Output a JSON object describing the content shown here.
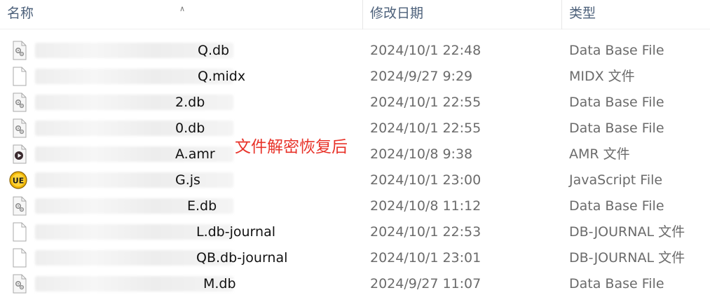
{
  "columns": {
    "name": "名称",
    "date": "修改日期",
    "type": "类型"
  },
  "overlay_text": "文件解密恢复后",
  "files": [
    {
      "name_suffix": "Q.db",
      "date": "2024/10/1 22:48",
      "type": "Data Base File",
      "icon": "database-file-icon"
    },
    {
      "name_suffix": "Q.midx",
      "date": "2024/9/27 9:29",
      "type": "MIDX 文件",
      "icon": "generic-file-icon"
    },
    {
      "name_suffix": "2.db",
      "date": "2024/10/1 22:55",
      "type": "Data Base File",
      "icon": "database-file-icon"
    },
    {
      "name_suffix": "0.db",
      "date": "2024/10/1 22:55",
      "type": "Data Base File",
      "icon": "database-file-icon"
    },
    {
      "name_suffix": "A.amr",
      "date": "2024/10/8 9:38",
      "type": "AMR 文件",
      "icon": "media-player-file-icon"
    },
    {
      "name_suffix": "G.js",
      "date": "2024/10/1 23:00",
      "type": "JavaScript File",
      "icon": "ultraedit-file-icon"
    },
    {
      "name_suffix": "E.db",
      "date": "2024/10/8 11:12",
      "type": "Data Base File",
      "icon": "database-file-icon"
    },
    {
      "name_suffix": "L.db-journal",
      "date": "2024/10/1 22:53",
      "type": "DB-JOURNAL 文件",
      "icon": "generic-file-icon"
    },
    {
      "name_suffix": "QB.db-journal",
      "date": "2024/10/1 23:01",
      "type": "DB-JOURNAL 文件",
      "icon": "generic-file-icon"
    },
    {
      "name_suffix": "M.db",
      "date": "2024/9/27 11:07",
      "type": "Data Base File",
      "icon": "database-file-icon"
    }
  ]
}
